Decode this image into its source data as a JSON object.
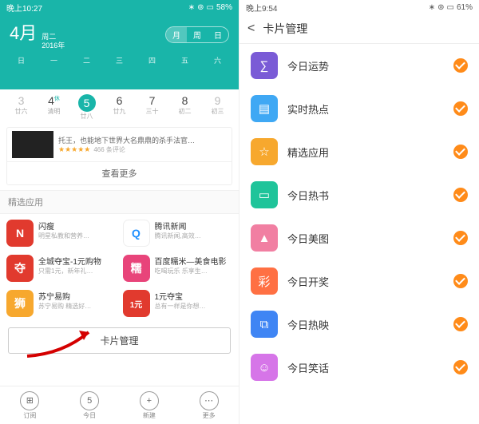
{
  "left": {
    "statusbar": {
      "time": "晚上10:27",
      "battery": "58%"
    },
    "month": "4月",
    "weekday": "周二",
    "year": "2016年",
    "seg": [
      "月",
      "周",
      "日"
    ],
    "weekdays": [
      "日",
      "一",
      "二",
      "三",
      "四",
      "五",
      "六"
    ],
    "days": [
      {
        "n": "3",
        "sub": "廿六"
      },
      {
        "n": "4",
        "sub": "清明",
        "sup": "休"
      },
      {
        "n": "5",
        "sub": "廿八"
      },
      {
        "n": "6",
        "sub": "廿九"
      },
      {
        "n": "7",
        "sub": "三十"
      },
      {
        "n": "8",
        "sub": "初二"
      },
      {
        "n": "9",
        "sub": "初三"
      }
    ],
    "featured": {
      "snippet": "托王，也能地下世界大名鼎鼎的杀手法官…",
      "reviews": "466 条评论"
    },
    "see_more": "查看更多",
    "section_apps": "精选应用",
    "apps": [
      {
        "name": "闪瘦",
        "desc": "明星私教和营养…",
        "glyph": "N",
        "bg": "#e13a2e"
      },
      {
        "name": "腾讯新闻",
        "desc": "腾讯新闻,高效…",
        "glyph": "Q",
        "bg": "#fff",
        "fg": "#1e90ff",
        "border": true
      },
      {
        "name": "全城夺宝-1元购物",
        "desc": "只需1元，新年礼…",
        "glyph": "夺",
        "bg": "#e13a2e"
      },
      {
        "name": "百度糯米—美食电影",
        "desc": "吃喝玩乐 乐享生…",
        "glyph": "糯",
        "bg": "#e8447a"
      },
      {
        "name": "苏宁易购",
        "desc": "苏宁易购 精选好…",
        "glyph": "狮",
        "bg": "#f7a82e"
      },
      {
        "name": "1元夺宝",
        "desc": "总有一样是你想…",
        "glyph": "1元",
        "bg": "#e13a2e"
      }
    ],
    "card_mgmt": "卡片管理",
    "tabs": [
      {
        "icon": "⊞",
        "label": "订阅"
      },
      {
        "icon": "5",
        "label": "今日"
      },
      {
        "icon": "+",
        "label": "新建"
      },
      {
        "icon": "⋯",
        "label": "更多"
      }
    ]
  },
  "right": {
    "statusbar": {
      "time": "晚上9:54",
      "battery": "61%"
    },
    "title": "卡片管理",
    "cards": [
      {
        "label": "今日运势",
        "glyph": "∑",
        "bg": "#7a5bd6"
      },
      {
        "label": "实时热点",
        "glyph": "▤",
        "bg": "#3fa8f4"
      },
      {
        "label": "精选应用",
        "glyph": "☆",
        "bg": "#f7a82e"
      },
      {
        "label": "今日热书",
        "glyph": "▭",
        "bg": "#1fc49a"
      },
      {
        "label": "今日美图",
        "glyph": "▲",
        "bg": "#f17fa2"
      },
      {
        "label": "今日开奖",
        "glyph": "彩",
        "bg": "#ff7043"
      },
      {
        "label": "今日热映",
        "glyph": "⧉",
        "bg": "#3f85f4"
      },
      {
        "label": "今日笑话",
        "glyph": "☺",
        "bg": "#d675e8"
      }
    ]
  }
}
